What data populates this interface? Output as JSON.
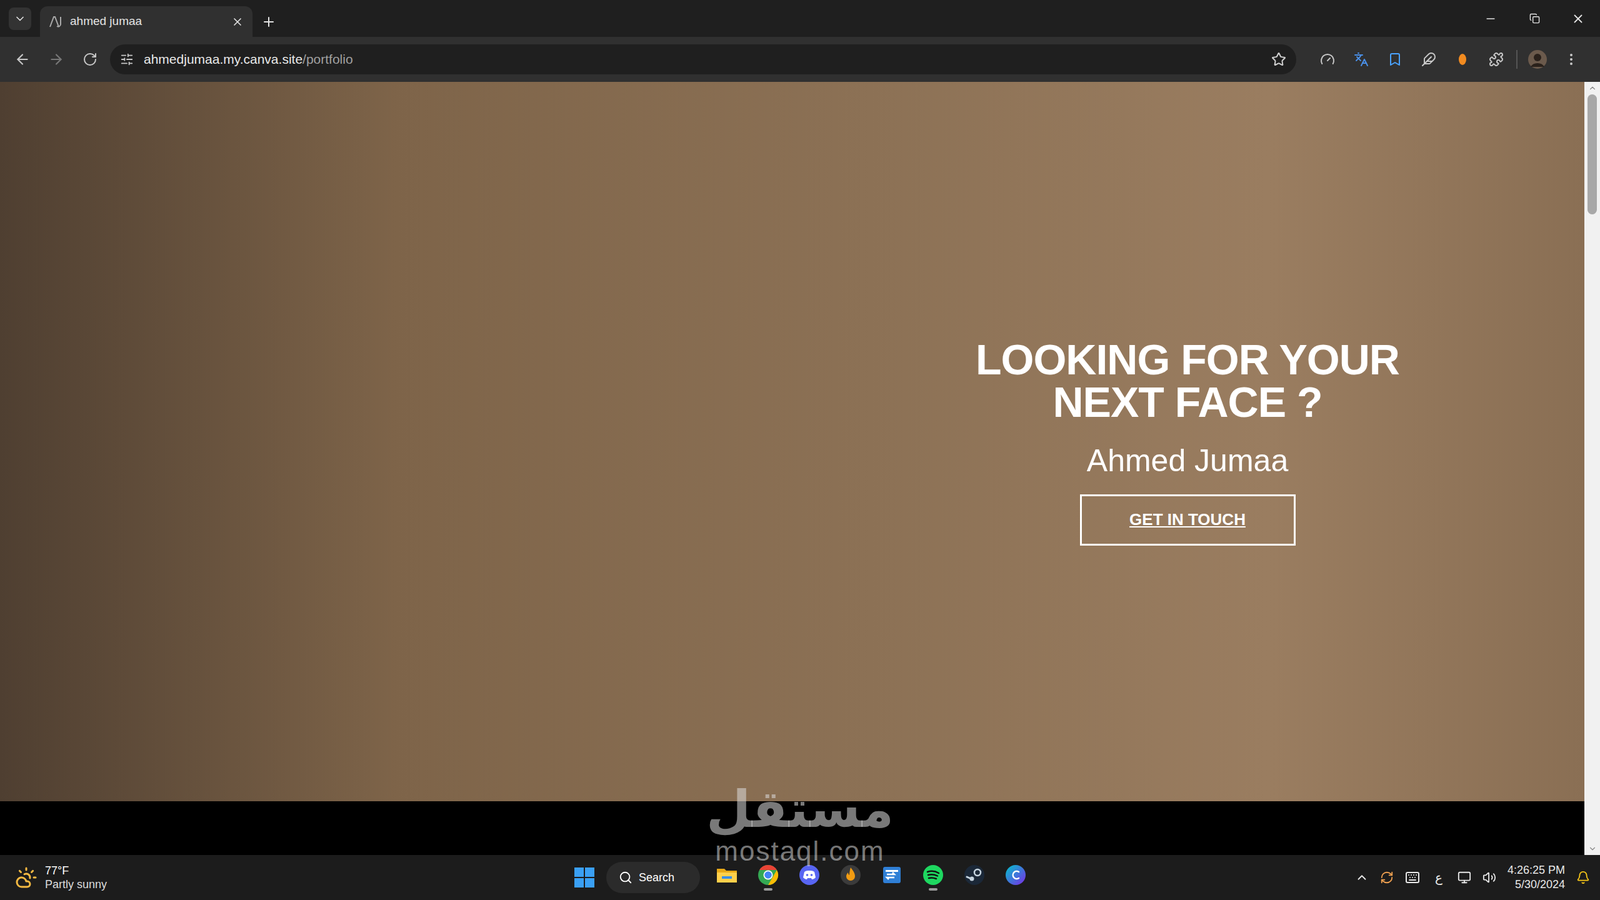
{
  "browser": {
    "tabs": [
      {
        "title": "ahmed jumaa",
        "selected": true
      }
    ],
    "address": {
      "host": "ahmedjumaa.my.canva.site",
      "path": "/portfolio"
    },
    "bookmarked": false
  },
  "page": {
    "hero": {
      "heading": [
        "LOOKING FOR YOUR",
        "NEXT FACE ?"
      ],
      "name": "Ahmed Jumaa",
      "button": "GET IN TOUCH"
    },
    "scrollbar": {
      "level": 0.16
    }
  },
  "watermark": {
    "arabic": "مستقل",
    "latin": "mostaql.com"
  },
  "taskbar": {
    "weather": {
      "temperature": "77°F",
      "condition": "Partly sunny"
    },
    "search": "Search",
    "apps": [
      {
        "kind": "explorer",
        "running": false
      },
      {
        "kind": "chrome",
        "running": true
      },
      {
        "kind": "discord",
        "running": false
      },
      {
        "kind": "flame",
        "running": false
      },
      {
        "kind": "remote",
        "running": false
      },
      {
        "kind": "spotify",
        "running": true
      },
      {
        "kind": "steam",
        "running": false
      },
      {
        "kind": "canva",
        "running": false
      }
    ],
    "language": "ع",
    "clock": {
      "time": "4:26:25 PM",
      "date": "5/30/2024"
    }
  }
}
